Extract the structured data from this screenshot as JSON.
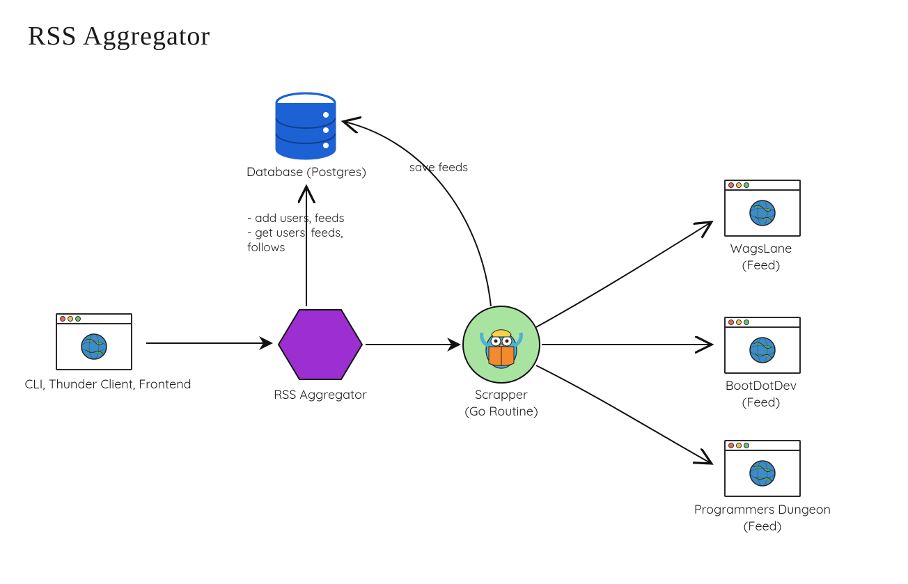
{
  "title": "RSS Aggregator",
  "nodes": {
    "client": {
      "label": "CLI, Thunder Client, Frontend",
      "icon": "browser-window-icon"
    },
    "aggregator": {
      "label": "RSS Aggregator",
      "icon": "hexagon-icon",
      "color": "#9d2fd2"
    },
    "database": {
      "label": "Database (Postgres)",
      "icon": "database-icon",
      "color": "#1c62d4"
    },
    "scrapper": {
      "label": "Scrapper\n(Go Routine)",
      "icon": "gopher-icon",
      "bg": "#a9e3a0"
    },
    "feed1": {
      "label": "WagsLane\n(Feed)",
      "icon": "browser-window-icon"
    },
    "feed2": {
      "label": "BootDotDev\n(Feed)",
      "icon": "browser-window-icon"
    },
    "feed3": {
      "label": "Programmers Dungeon\n(Feed)",
      "icon": "browser-window-icon"
    }
  },
  "edges": {
    "client_to_aggregator": {
      "label": ""
    },
    "aggregator_to_database": {
      "label": "- add users, feeds\n- get users, feeds,\nfollows"
    },
    "aggregator_to_scrapper": {
      "label": ""
    },
    "scrapper_to_database": {
      "label": "save feeds"
    },
    "scrapper_to_feed1": {
      "label": ""
    },
    "scrapper_to_feed2": {
      "label": ""
    },
    "scrapper_to_feed3": {
      "label": ""
    }
  }
}
